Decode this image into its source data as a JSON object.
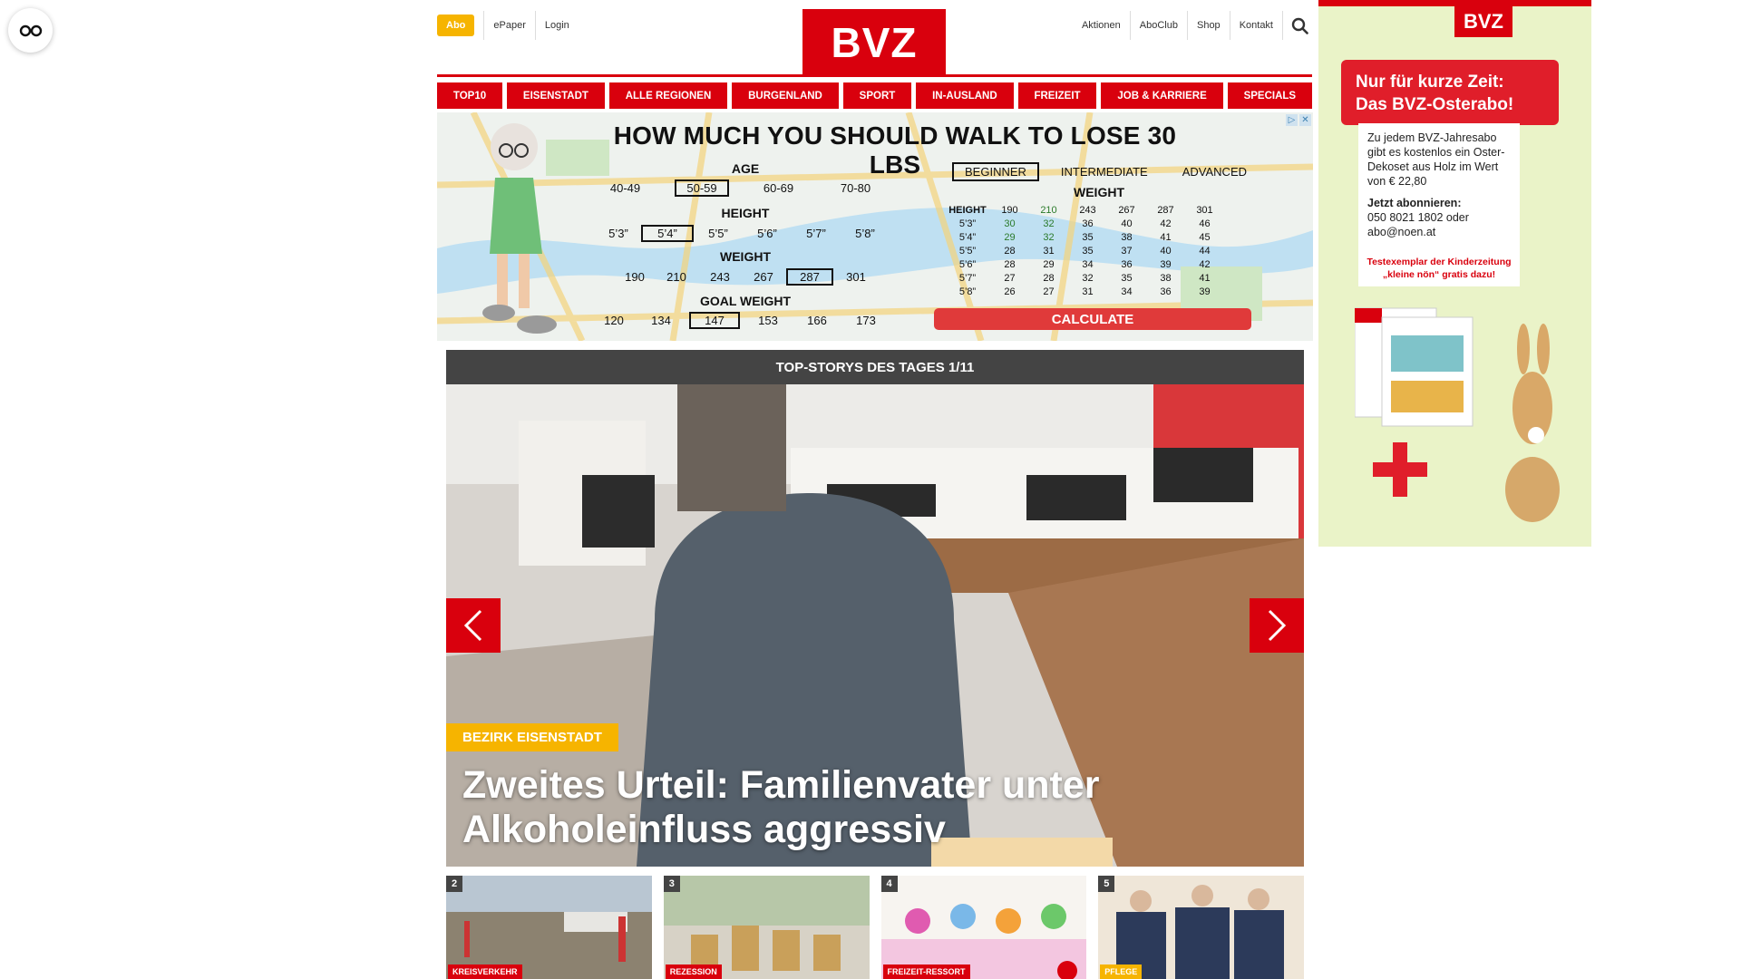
{
  "header": {
    "abo_label": "Abo",
    "left_links": [
      "ePaper",
      "Login"
    ],
    "logo_text": "BVZ",
    "right_links": [
      "Aktionen",
      "AboClub",
      "Shop",
      "Kontakt"
    ]
  },
  "nav": {
    "items": [
      "TOP10",
      "EISENSTADT",
      "ALLE REGIONEN",
      "BURGENLAND",
      "SPORT",
      "IN-AUSLAND",
      "FREIZEIT",
      "JOB & KARRIERE",
      "SPECIALS"
    ]
  },
  "walk_ad": {
    "title": "HOW MUCH YOU SHOULD WALK TO LOSE 30 LBS",
    "age_label": "AGE",
    "ages": [
      "40-49",
      "50-59",
      "60-69",
      "70-80"
    ],
    "height_label": "HEIGHT",
    "heights": [
      "5’3”",
      "5’4”",
      "5’5”",
      "5’6”",
      "5’7”",
      "5’8”"
    ],
    "weight_label": "WEIGHT",
    "weights": [
      "190",
      "210",
      "243",
      "267",
      "287",
      "301"
    ],
    "goal_label": "GOAL WEIGHT",
    "goals": [
      "120",
      "134",
      "147",
      "153",
      "166",
      "173"
    ],
    "levels": [
      "BEGINNER",
      "INTERMEDIATE",
      "ADVANCED"
    ],
    "table_weight_label": "WEIGHT",
    "table_height_label": "HEIGHT",
    "table_cols": [
      "190",
      "210",
      "243",
      "267",
      "287",
      "301"
    ],
    "table_rows": [
      {
        "h": "5’3”",
        "v": [
          "30",
          "32",
          "36",
          "40",
          "42",
          "46"
        ]
      },
      {
        "h": "5’4”",
        "v": [
          "29",
          "32",
          "35",
          "38",
          "41",
          "45"
        ]
      },
      {
        "h": "5’5”",
        "v": [
          "28",
          "31",
          "35",
          "37",
          "40",
          "44"
        ]
      },
      {
        "h": "5’6”",
        "v": [
          "28",
          "29",
          "34",
          "36",
          "39",
          "42"
        ]
      },
      {
        "h": "5’7”",
        "v": [
          "27",
          "28",
          "32",
          "35",
          "38",
          "41"
        ]
      },
      {
        "h": "5’8”",
        "v": [
          "26",
          "27",
          "31",
          "34",
          "36",
          "39"
        ]
      }
    ],
    "calc_label": "CALCULATE"
  },
  "slider": {
    "header": "TOP-STORYS DES TAGES 1/11",
    "tag": "BEZIRK EISENSTADT",
    "title": "Zweites Urteil: Familienvater unter Alkoholeinfluss aggressiv"
  },
  "thumbs": [
    {
      "num": "2",
      "tag": "KREISVERKEHR"
    },
    {
      "num": "3",
      "tag": "REZESSION"
    },
    {
      "num": "4",
      "tag": "FREIZEIT-RESSORT"
    },
    {
      "num": "5",
      "tag": "PFLEGE"
    }
  ],
  "side_ad": {
    "logo": "BVZ",
    "banner_line1": "Nur für kurze Zeit:",
    "banner_line2": "Das BVZ-Osterabo!",
    "body": "Zu jedem BVZ-Jahresabo gibt es kostenlos ein Oster-Dekoset aus Holz im Wert von € 22,80",
    "cta_title": "Jetzt abonnieren:",
    "cta_phone": "050 8021 1802 oder",
    "cta_email": "abo@noen.at",
    "test_line": "Testexemplar der Kinderzeitung „kleine nön“ gratis dazu!"
  },
  "colors": {
    "brand_red": "#d9000d",
    "abo_yellow": "#f6b400",
    "slider_header": "#444444"
  }
}
